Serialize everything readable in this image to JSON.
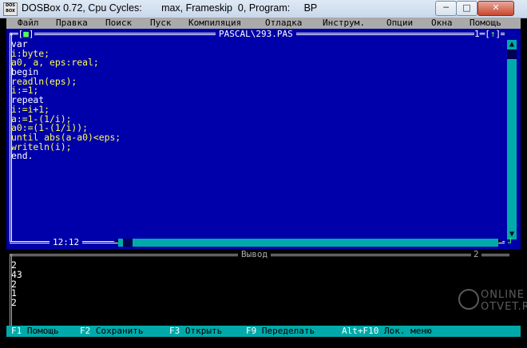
{
  "window": {
    "title": "DOSBox 0.72, Cpu Cycles:       max, Frameskip  0, Program:     BP",
    "icon_text": "DOS BOX",
    "minimize_glyph": "─",
    "maximize_glyph": "□",
    "close_glyph": "✕"
  },
  "menu": {
    "items": [
      "Файл",
      "Правка",
      "Поиск",
      "Пуск",
      "Компиляция",
      "Отладка",
      "Инструм.",
      "Опции",
      "Окна",
      "Помощь"
    ]
  },
  "editor": {
    "title": "PASCAL\\293.PAS",
    "close_box_left": "═[",
    "close_box_mark": "■",
    "close_box_right": "]",
    "window_number": "1",
    "zoom_mark": "↑",
    "cursor_position": "12:12",
    "code_lines": [
      {
        "text": "var",
        "kw": true
      },
      {
        "text": "i:byte;",
        "kw": false
      },
      {
        "text": "a0, a, eps:real;",
        "kw": false
      },
      {
        "text": "begin",
        "kw": true
      },
      {
        "text": "readln(eps);",
        "kw": false
      },
      {
        "text": "i:=1;",
        "kw": false
      },
      {
        "text": "repeat",
        "kw": true
      },
      {
        "text": "i:=i+1;",
        "kw": false
      },
      {
        "text": "a:=1-(1/i);",
        "kw": false
      },
      {
        "text": "a0:=(1-(1/i));",
        "kw": false
      },
      {
        "text": "until abs(a-a0)<eps;",
        "kw": false
      },
      {
        "text": "writeln(i);",
        "kw": false
      },
      {
        "text": "end.",
        "kw": true
      }
    ],
    "scroll_up_arrow": "▲",
    "scroll_down_arrow": "▼",
    "hscroll_left": "◄",
    "hscroll_right": "►",
    "resize_mark": "┘"
  },
  "output": {
    "title": "Вывод",
    "window_number": "2",
    "lines": [
      "2",
      "43",
      "2",
      "1",
      "2"
    ]
  },
  "fkeys": [
    {
      "key": "F1",
      "label": "Помощь"
    },
    {
      "key": "F2",
      "label": "Сохранить"
    },
    {
      "key": "F3",
      "label": "Открыть"
    },
    {
      "key": "F9",
      "label": "Переделать"
    },
    {
      "key": "Alt+F10",
      "label": "Лок. меню"
    }
  ],
  "watermark": {
    "line1": "ONLINE",
    "line2": "OTVET.RU"
  }
}
